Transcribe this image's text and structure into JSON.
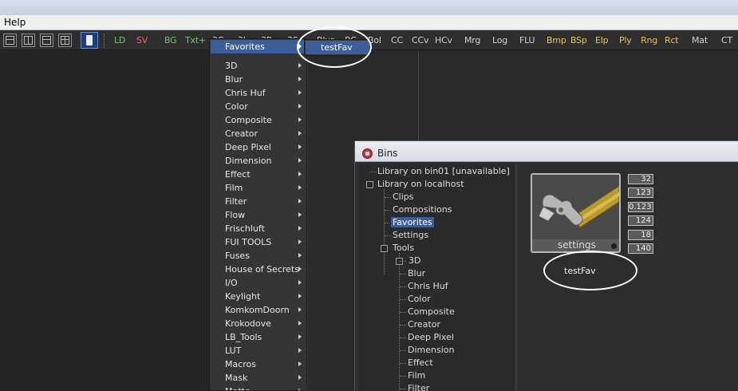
{
  "menubar": {
    "help": "Help"
  },
  "toolbar": {
    "buttons": [
      {
        "label": "LD",
        "color": "#6fc26f"
      },
      {
        "label": "SV",
        "color": "#e06b6b"
      },
      {
        "label": "BG",
        "color": "#6fc26f"
      },
      {
        "label": "Txt+",
        "color": "#6fc26f"
      },
      {
        "label": "3C",
        "color": "#cfcfcf"
      },
      {
        "label": "3L",
        "color": "#cfcfcf"
      },
      {
        "label": "3R",
        "color": "#cfcfcf"
      },
      {
        "label": "3S",
        "color": "#cfcfcf"
      },
      {
        "label": "Blur",
        "color": "#cfcfcf"
      },
      {
        "label": "BC",
        "color": "#cfcfcf"
      },
      {
        "label": "Bol",
        "color": "#cfcfcf"
      },
      {
        "label": "CC",
        "color": "#cfcfcf"
      },
      {
        "label": "CCv",
        "color": "#cfcfcf"
      },
      {
        "label": "HCv",
        "color": "#cfcfcf"
      },
      {
        "label": "Mrg",
        "color": "#cfcfcf"
      },
      {
        "label": "Log",
        "color": "#cfcfcf"
      },
      {
        "label": "FLU",
        "color": "#cfcfcf"
      },
      {
        "label": "Bmp",
        "color": "#e8c060"
      },
      {
        "label": "BSp",
        "color": "#e8c060"
      },
      {
        "label": "Elp",
        "color": "#e8c060"
      },
      {
        "label": "Ply",
        "color": "#e8c060"
      },
      {
        "label": "Rng",
        "color": "#e8c060"
      },
      {
        "label": "Rct",
        "color": "#e8c060"
      },
      {
        "label": "Mat",
        "color": "#cfcfcf"
      },
      {
        "label": "CT",
        "color": "#cfcfcf"
      }
    ]
  },
  "popup": {
    "highlighted": "Favorites",
    "items": [
      "3D",
      "Blur",
      "Chris Huf",
      "Color",
      "Composite",
      "Creator",
      "Deep Pixel",
      "Dimension",
      "Effect",
      "Film",
      "Filter",
      "Flow",
      "Frischluft",
      "FUI TOOLS",
      "Fuses",
      "House of Secrets",
      "I/O",
      "Keylight",
      "KomkomDoorn",
      "Krokodove",
      "LB_Tools",
      "LUT",
      "Macros",
      "Mask",
      "Matte"
    ]
  },
  "submenu": {
    "item": "testFav"
  },
  "bins": {
    "title": "Bins",
    "tree": {
      "lib_bin01": "Library on bin01 [unavailable]",
      "lib_localhost": "Library on localhost",
      "clips": "Clips",
      "compositions": "Compositions",
      "favorites": "Favorites",
      "settings": "Settings",
      "tools": "Tools",
      "tool_items": [
        "3D",
        "Blur",
        "Chris Huf",
        "Color",
        "Composite",
        "Creator",
        "Deep Pixel",
        "Dimension",
        "Effect",
        "Film",
        "Filter"
      ]
    },
    "thumbnail": {
      "caption": "settings",
      "name": "testFav",
      "stats": [
        "32",
        "123",
        "0.123",
        "124",
        "18",
        "140"
      ]
    }
  }
}
